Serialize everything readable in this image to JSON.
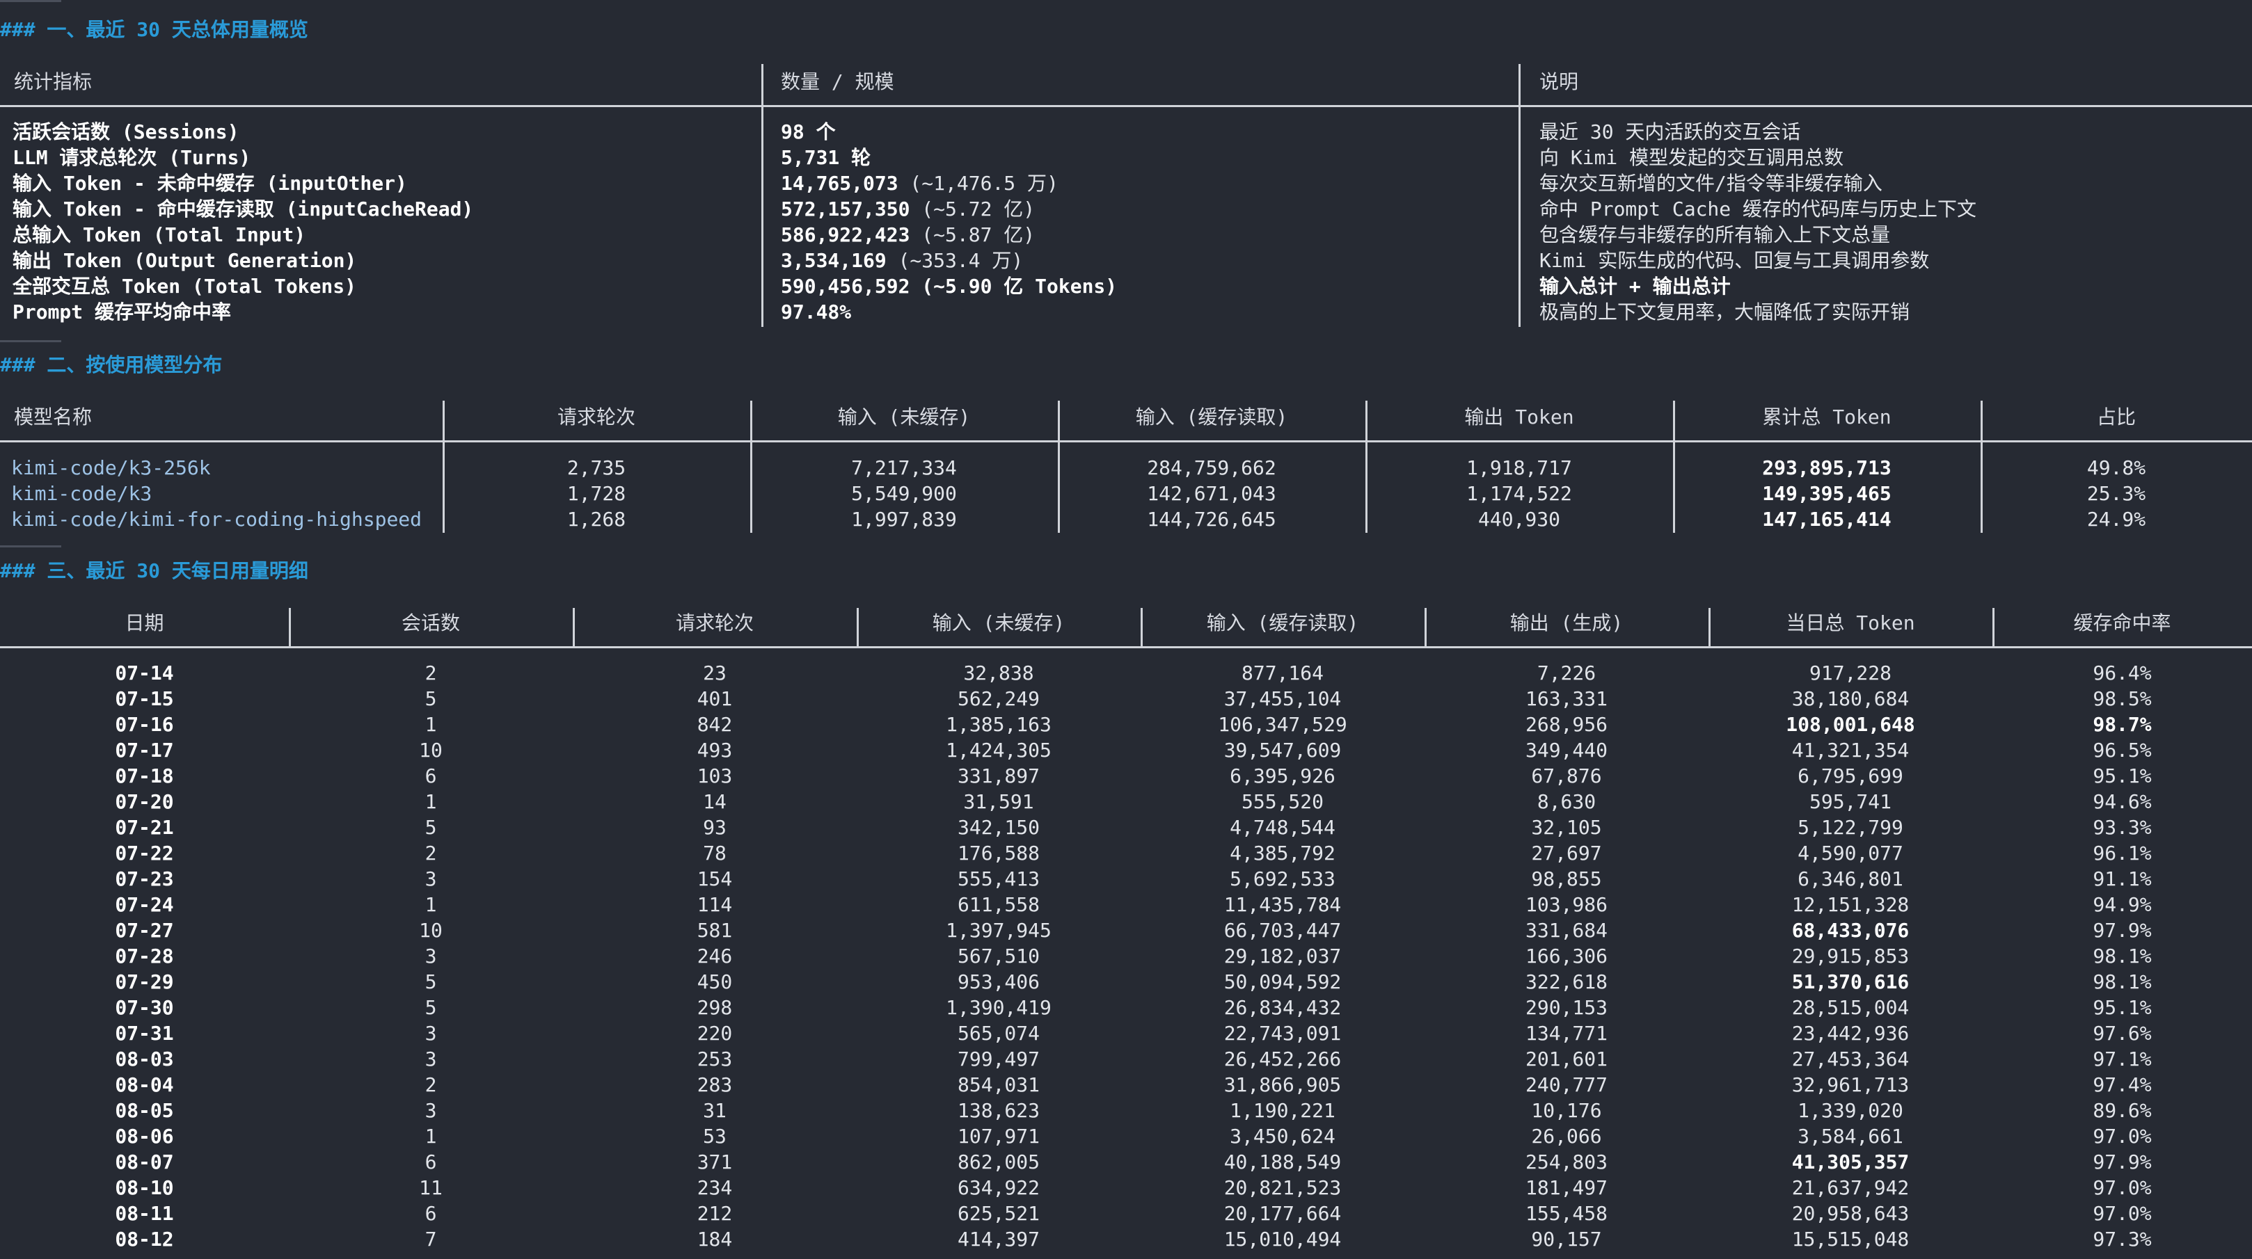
{
  "sections": {
    "s1": "### 一、最近 30 天总体用量概览",
    "s2": "### 二、按使用模型分布",
    "s3": "### 三、最近 30 天每日用量明细"
  },
  "overview": {
    "headers": [
      "统计指标",
      "数量 / 规模",
      "说明"
    ],
    "rows": [
      {
        "metric": "活跃会话数 (Sessions)",
        "value": "98 个",
        "value_extra": "",
        "desc": "最近 30 天内活跃的交互会话",
        "desc_bold": false
      },
      {
        "metric": "LLM 请求总轮次 (Turns)",
        "value": "5,731 轮",
        "value_extra": "",
        "desc": "向 Kimi 模型发起的交互调用总数",
        "desc_bold": false
      },
      {
        "metric": "输入 Token - 未命中缓存 (inputOther)",
        "value": "14,765,073",
        "value_extra": " (~1,476.5 万)",
        "desc": "每次交互新增的文件/指令等非缓存输入",
        "desc_bold": false
      },
      {
        "metric": "输入 Token - 命中缓存读取 (inputCacheRead)",
        "value": "572,157,350",
        "value_extra": " (~5.72 亿)",
        "desc": "命中 Prompt Cache 缓存的代码库与历史上下文",
        "desc_bold": false
      },
      {
        "metric": "总输入 Token (Total Input)",
        "value": "586,922,423",
        "value_extra": " (~5.87 亿)",
        "desc": "包含缓存与非缓存的所有输入上下文总量",
        "desc_bold": false
      },
      {
        "metric": "输出 Token (Output Generation)",
        "value": "3,534,169",
        "value_extra": " (~353.4 万)",
        "desc": "Kimi 实际生成的代码、回复与工具调用参数",
        "desc_bold": false
      },
      {
        "metric": "全部交互总 Token (Total Tokens)",
        "value": "590,456,592 (~5.90 亿 Tokens)",
        "value_extra": "",
        "desc": "输入总计 + 输出总计",
        "desc_bold": true
      },
      {
        "metric": "Prompt 缓存平均命中率",
        "value": "97.48%",
        "value_extra": "",
        "desc": "极高的上下文复用率，大幅降低了实际开销",
        "desc_bold": false
      }
    ]
  },
  "models": {
    "headers": [
      "模型名称",
      "请求轮次",
      "输入 (未缓存)",
      "输入 (缓存读取)",
      "输出 Token",
      "累计总 Token",
      "占比"
    ],
    "rows": [
      {
        "name": "kimi-code/k3-256k",
        "turns": "2,735",
        "input_other": "7,217,334",
        "input_cache": "284,759,662",
        "output": "1,918,717",
        "total": "293,895,713",
        "share": "49.8%"
      },
      {
        "name": "kimi-code/k3",
        "turns": "1,728",
        "input_other": "5,549,900",
        "input_cache": "142,671,043",
        "output": "1,174,522",
        "total": "149,395,465",
        "share": "25.3%"
      },
      {
        "name": "kimi-code/kimi-for-coding-highspeed",
        "turns": "1,268",
        "input_other": "1,997,839",
        "input_cache": "144,726,645",
        "output": "440,930",
        "total": "147,165,414",
        "share": "24.9%"
      }
    ]
  },
  "daily": {
    "headers": [
      "日期",
      "会话数",
      "请求轮次",
      "输入 (未缓存)",
      "输入 (缓存读取)",
      "输出 (生成)",
      "当日总 Token",
      "缓存命中率"
    ],
    "rows": [
      {
        "date": "07-14",
        "sessions": "2",
        "turns": "23",
        "input_other": "32,838",
        "input_cache": "877,164",
        "output": "7,226",
        "total": "917,228",
        "hit": "96.4%",
        "total_bold": false,
        "hit_bold": false
      },
      {
        "date": "07-15",
        "sessions": "5",
        "turns": "401",
        "input_other": "562,249",
        "input_cache": "37,455,104",
        "output": "163,331",
        "total": "38,180,684",
        "hit": "98.5%",
        "total_bold": false,
        "hit_bold": false
      },
      {
        "date": "07-16",
        "sessions": "1",
        "turns": "842",
        "input_other": "1,385,163",
        "input_cache": "106,347,529",
        "output": "268,956",
        "total": "108,001,648",
        "hit": "98.7%",
        "total_bold": true,
        "hit_bold": true
      },
      {
        "date": "07-17",
        "sessions": "10",
        "turns": "493",
        "input_other": "1,424,305",
        "input_cache": "39,547,609",
        "output": "349,440",
        "total": "41,321,354",
        "hit": "96.5%",
        "total_bold": false,
        "hit_bold": false
      },
      {
        "date": "07-18",
        "sessions": "6",
        "turns": "103",
        "input_other": "331,897",
        "input_cache": "6,395,926",
        "output": "67,876",
        "total": "6,795,699",
        "hit": "95.1%",
        "total_bold": false,
        "hit_bold": false
      },
      {
        "date": "07-20",
        "sessions": "1",
        "turns": "14",
        "input_other": "31,591",
        "input_cache": "555,520",
        "output": "8,630",
        "total": "595,741",
        "hit": "94.6%",
        "total_bold": false,
        "hit_bold": false
      },
      {
        "date": "07-21",
        "sessions": "5",
        "turns": "93",
        "input_other": "342,150",
        "input_cache": "4,748,544",
        "output": "32,105",
        "total": "5,122,799",
        "hit": "93.3%",
        "total_bold": false,
        "hit_bold": false
      },
      {
        "date": "07-22",
        "sessions": "2",
        "turns": "78",
        "input_other": "176,588",
        "input_cache": "4,385,792",
        "output": "27,697",
        "total": "4,590,077",
        "hit": "96.1%",
        "total_bold": false,
        "hit_bold": false
      },
      {
        "date": "07-23",
        "sessions": "3",
        "turns": "154",
        "input_other": "555,413",
        "input_cache": "5,692,533",
        "output": "98,855",
        "total": "6,346,801",
        "hit": "91.1%",
        "total_bold": false,
        "hit_bold": false
      },
      {
        "date": "07-24",
        "sessions": "1",
        "turns": "114",
        "input_other": "611,558",
        "input_cache": "11,435,784",
        "output": "103,986",
        "total": "12,151,328",
        "hit": "94.9%",
        "total_bold": false,
        "hit_bold": false
      },
      {
        "date": "07-27",
        "sessions": "10",
        "turns": "581",
        "input_other": "1,397,945",
        "input_cache": "66,703,447",
        "output": "331,684",
        "total": "68,433,076",
        "hit": "97.9%",
        "total_bold": true,
        "hit_bold": false
      },
      {
        "date": "07-28",
        "sessions": "3",
        "turns": "246",
        "input_other": "567,510",
        "input_cache": "29,182,037",
        "output": "166,306",
        "total": "29,915,853",
        "hit": "98.1%",
        "total_bold": false,
        "hit_bold": false
      },
      {
        "date": "07-29",
        "sessions": "5",
        "turns": "450",
        "input_other": "953,406",
        "input_cache": "50,094,592",
        "output": "322,618",
        "total": "51,370,616",
        "hit": "98.1%",
        "total_bold": true,
        "hit_bold": false
      },
      {
        "date": "07-30",
        "sessions": "5",
        "turns": "298",
        "input_other": "1,390,419",
        "input_cache": "26,834,432",
        "output": "290,153",
        "total": "28,515,004",
        "hit": "95.1%",
        "total_bold": false,
        "hit_bold": false
      },
      {
        "date": "07-31",
        "sessions": "3",
        "turns": "220",
        "input_other": "565,074",
        "input_cache": "22,743,091",
        "output": "134,771",
        "total": "23,442,936",
        "hit": "97.6%",
        "total_bold": false,
        "hit_bold": false
      },
      {
        "date": "08-03",
        "sessions": "3",
        "turns": "253",
        "input_other": "799,497",
        "input_cache": "26,452,266",
        "output": "201,601",
        "total": "27,453,364",
        "hit": "97.1%",
        "total_bold": false,
        "hit_bold": false
      },
      {
        "date": "08-04",
        "sessions": "2",
        "turns": "283",
        "input_other": "854,031",
        "input_cache": "31,866,905",
        "output": "240,777",
        "total": "32,961,713",
        "hit": "97.4%",
        "total_bold": false,
        "hit_bold": false
      },
      {
        "date": "08-05",
        "sessions": "3",
        "turns": "31",
        "input_other": "138,623",
        "input_cache": "1,190,221",
        "output": "10,176",
        "total": "1,339,020",
        "hit": "89.6%",
        "total_bold": false,
        "hit_bold": false
      },
      {
        "date": "08-06",
        "sessions": "1",
        "turns": "53",
        "input_other": "107,971",
        "input_cache": "3,450,624",
        "output": "26,066",
        "total": "3,584,661",
        "hit": "97.0%",
        "total_bold": false,
        "hit_bold": false
      },
      {
        "date": "08-07",
        "sessions": "6",
        "turns": "371",
        "input_other": "862,005",
        "input_cache": "40,188,549",
        "output": "254,803",
        "total": "41,305,357",
        "hit": "97.9%",
        "total_bold": true,
        "hit_bold": false
      },
      {
        "date": "08-10",
        "sessions": "11",
        "turns": "234",
        "input_other": "634,922",
        "input_cache": "20,821,523",
        "output": "181,497",
        "total": "21,637,942",
        "hit": "97.0%",
        "total_bold": false,
        "hit_bold": false
      },
      {
        "date": "08-11",
        "sessions": "6",
        "turns": "212",
        "input_other": "625,521",
        "input_cache": "20,177,664",
        "output": "155,458",
        "total": "20,958,643",
        "hit": "97.0%",
        "total_bold": false,
        "hit_bold": false
      },
      {
        "date": "08-12",
        "sessions": "7",
        "turns": "184",
        "input_other": "414,397",
        "input_cache": "15,010,494",
        "output": "90,157",
        "total": "15,515,048",
        "hit": "97.3%",
        "total_bold": false,
        "hit_bold": false
      }
    ]
  },
  "colors": {
    "background": "#262a33",
    "heading": "#2a9bd8",
    "link": "#9ec3e6",
    "text": "#e2e5ea"
  }
}
